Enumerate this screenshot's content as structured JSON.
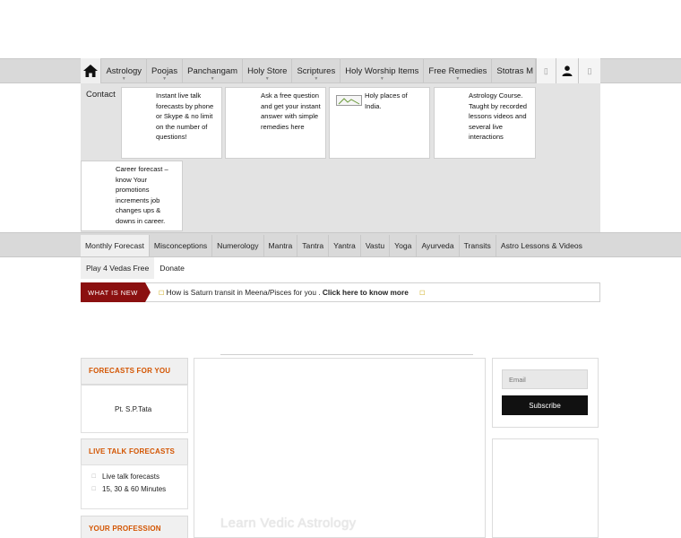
{
  "nav": {
    "items": [
      {
        "label": "Astrology"
      },
      {
        "label": "Poojas"
      },
      {
        "label": "Panchangam"
      },
      {
        "label": "Holy Store"
      },
      {
        "label": "Scriptures"
      },
      {
        "label": "Holy Worship Items"
      },
      {
        "label": "Free Remedies"
      },
      {
        "label": "Stotras M"
      }
    ],
    "box_glyph": "▯"
  },
  "dropdown": {
    "contact_label": "Contact",
    "cards": [
      {
        "lines": [
          "Instant live talk",
          "forecasts by phone",
          "or Skype & no limit",
          "on the number of",
          "questions!"
        ]
      },
      {
        "lines": [
          "Ask a free question",
          "and get your instant",
          "answer with simple",
          "remedies here"
        ]
      },
      {
        "lines": [
          "Holy places of",
          "India."
        ]
      },
      {
        "lines": [
          "Astrology Course.",
          "Taught by recorded",
          "lessons videos and",
          "several live",
          "interactions"
        ]
      },
      {
        "lines": [
          "Career forecast –",
          "know Your",
          "promotions",
          "increments job",
          "changes ups &",
          "downs in career."
        ]
      }
    ]
  },
  "menu2": {
    "row1": [
      "Monthly Forecast",
      "Misconceptions",
      "Numerology",
      "Mantra",
      "Tantra",
      "Yantra",
      "Vastu",
      "Yoga",
      "Ayurveda",
      "Transits",
      "Astro Lessons & Videos"
    ],
    "row2": [
      "Play 4 Vedas Free",
      "Donate"
    ]
  },
  "whatsnew": {
    "label": "WHAT IS NEW",
    "text": "How is Saturn transit in Meena/Pisces for you .",
    "link": "Click here to know more"
  },
  "sidebar": {
    "forecasts_title": "FORECASTS FOR YOU",
    "forecasts_name": "Pt. S.P.Tata",
    "live_title": "LIVE TALK FORECASTS",
    "live_items": [
      "Live talk forecasts",
      "15, 30 & 60 Minutes"
    ],
    "profession_title": "YOUR PROFESSION"
  },
  "center": {
    "watermark": "Learn Vedic Astrology"
  },
  "subscribe": {
    "email_placeholder": "Email",
    "button_label": "Subscribe"
  },
  "colors": {
    "accent_red": "#8b1010",
    "section_title_orange": "#d35400"
  }
}
